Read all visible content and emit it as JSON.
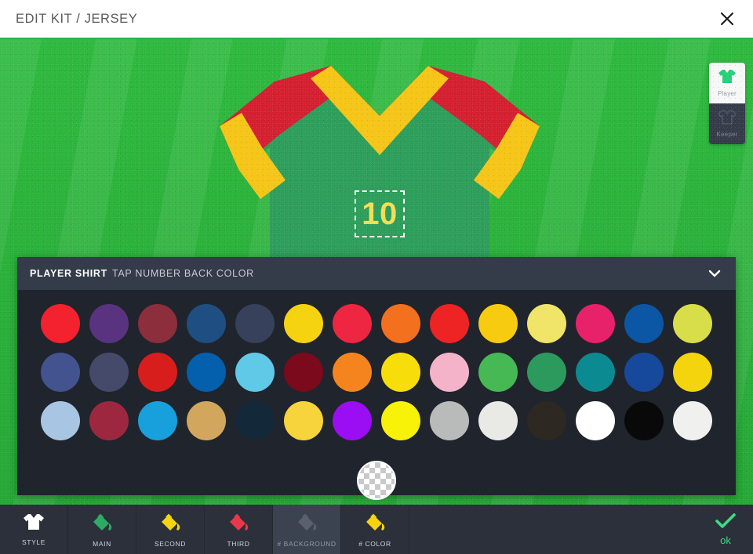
{
  "titlebar": {
    "title": "EDIT KIT / JERSEY",
    "close_icon": "close-icon"
  },
  "kit_mode": {
    "items": [
      {
        "label": "Player",
        "icon": "jersey-icon",
        "active": true
      },
      {
        "label": "Keeper",
        "icon": "jersey-icon",
        "active": false
      }
    ]
  },
  "jersey": {
    "body_color": "#2e9e5b",
    "stripe_primary": "#d42030",
    "stripe_secondary": "#f5c518",
    "cuff_color": "#f5c518",
    "number": "10",
    "number_color": "#f5dd55",
    "selection": "number-selection-box"
  },
  "panel": {
    "title": "PLAYER SHIRT",
    "subtitle": "TAP NUMBER BACK COLOR",
    "collapse_icon": "chevron-down-icon",
    "rows": [
      [
        "#f4212e",
        "#5a3380",
        "#8c2e3c",
        "#1f4f82",
        "#37415c",
        "#f5d311",
        "#ee2642",
        "#f2701e",
        "#ee2323",
        "#f7cc10",
        "#f0e469",
        "#e8216b",
        "#0b57a6",
        "#d8de4a"
      ],
      [
        "#43538f",
        "#454a6b",
        "#d81d1d",
        "#045fad",
        "#61c9e8",
        "#7a0a1c",
        "#f5841f",
        "#f7de0b",
        "#f4b3c8",
        "#46b955",
        "#2c9a5c",
        "#0b8a91",
        "#16489c",
        "#f4d40c"
      ],
      [
        "#a8c6e3",
        "#9e2740",
        "#18a0dc",
        "#d3a65e",
        "#132838",
        "#f7d33c",
        "#9b0df2",
        "#f8f208",
        "#b9bbbb",
        "#e9e9e6",
        "#2d2822",
        "#ffffff",
        "#090909",
        "#f0f0ee"
      ]
    ],
    "extra_swatch": {
      "label": "transparent",
      "icon": "transparency-checker-icon"
    }
  },
  "toolbar": {
    "items": [
      {
        "label": "STYLE",
        "icon": "shirt-icon",
        "color": "#ffffff",
        "active": false
      },
      {
        "label": "MAIN",
        "icon": "paint-bucket-icon",
        "color": "#2eab63",
        "active": false
      },
      {
        "label": "SECOND",
        "icon": "paint-bucket-icon",
        "color": "#f5d311",
        "active": false
      },
      {
        "label": "THIRD",
        "icon": "paint-bucket-icon",
        "color": "#e8384a",
        "active": false
      },
      {
        "label": "# BACKGROUND",
        "icon": "paint-bucket-icon",
        "color": "#5a6070",
        "active": true
      },
      {
        "label": "# COLOR",
        "icon": "paint-bucket-icon",
        "color": "#f5d311",
        "active": false
      }
    ],
    "ok": {
      "label": "ok",
      "icon": "check-icon",
      "color": "#3ddc84"
    }
  }
}
